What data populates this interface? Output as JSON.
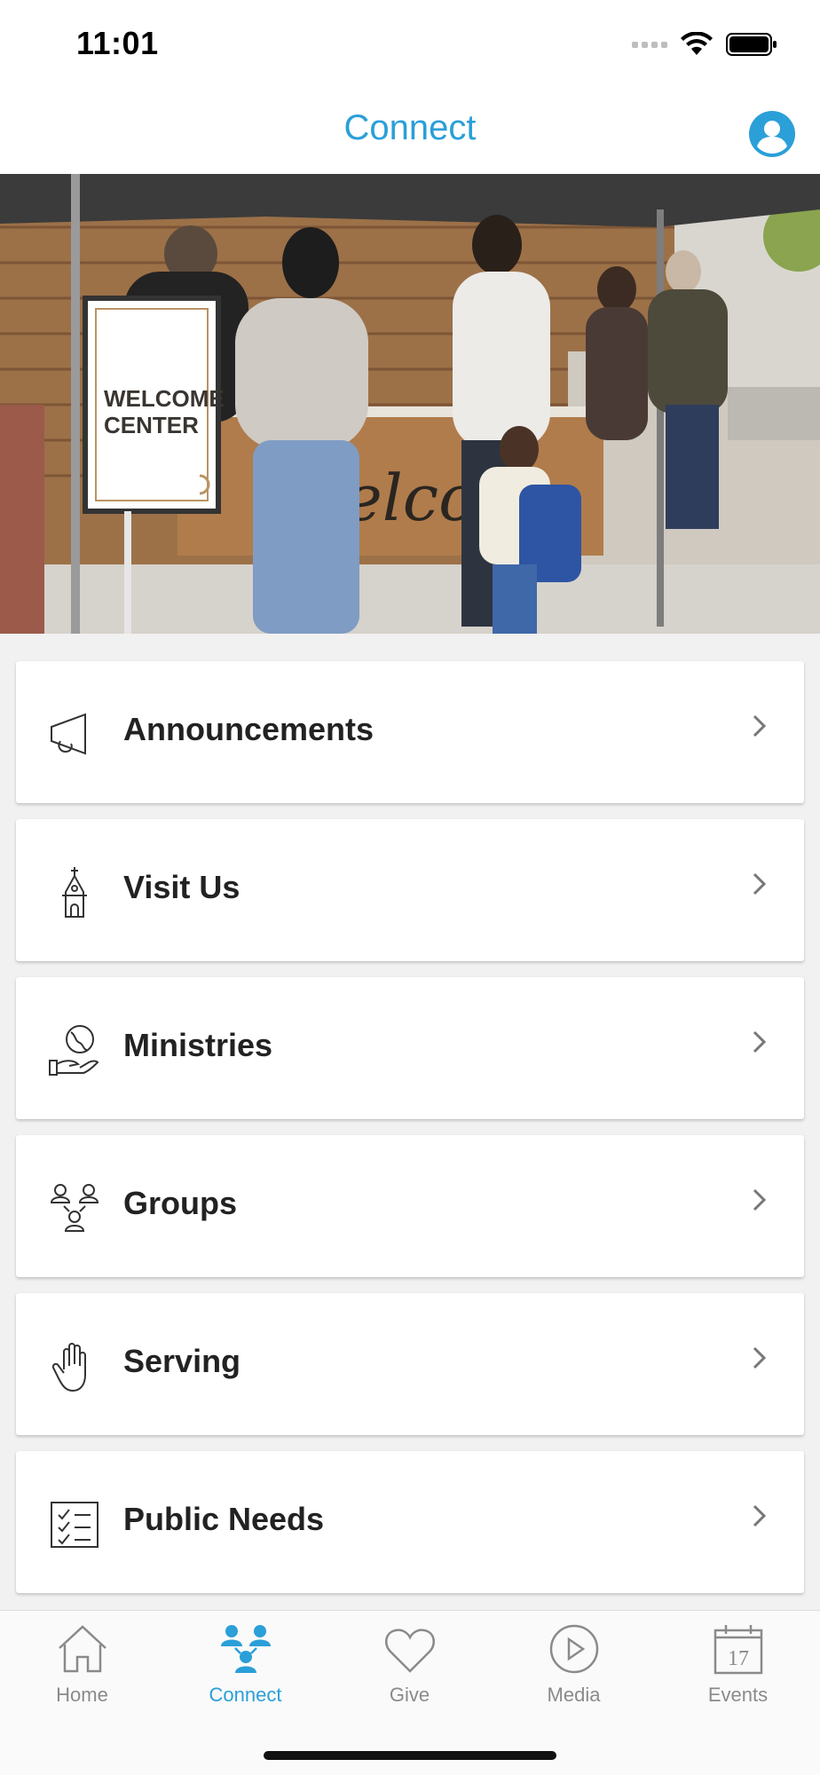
{
  "status_bar": {
    "time": "11:01"
  },
  "header": {
    "title": "Connect",
    "profile_icon": "user-circle-icon"
  },
  "hero": {
    "sign_text_line1": "WELCOME",
    "sign_text_line2": "CENTER",
    "counter_text": "Welcome"
  },
  "menu": {
    "items": [
      {
        "label": "Announcements",
        "icon": "megaphone-icon"
      },
      {
        "label": "Visit Us",
        "icon": "church-icon"
      },
      {
        "label": "Ministries",
        "icon": "hand-globe-icon"
      },
      {
        "label": "Groups",
        "icon": "group-icon"
      },
      {
        "label": "Serving",
        "icon": "hand-icon"
      },
      {
        "label": "Public Needs",
        "icon": "checklist-icon"
      }
    ]
  },
  "tabbar": {
    "tabs": [
      {
        "label": "Home",
        "icon": "home-icon",
        "active": false
      },
      {
        "label": "Connect",
        "icon": "people-icon",
        "active": true
      },
      {
        "label": "Give",
        "icon": "heart-icon",
        "active": false
      },
      {
        "label": "Media",
        "icon": "play-icon",
        "active": false
      },
      {
        "label": "Events",
        "icon": "calendar-icon",
        "active": false,
        "date": "17"
      }
    ]
  },
  "colors": {
    "accent": "#2a9fd8",
    "text": "#222222",
    "inactive": "#8a8a8a",
    "list_bg": "#f1f1f1"
  }
}
